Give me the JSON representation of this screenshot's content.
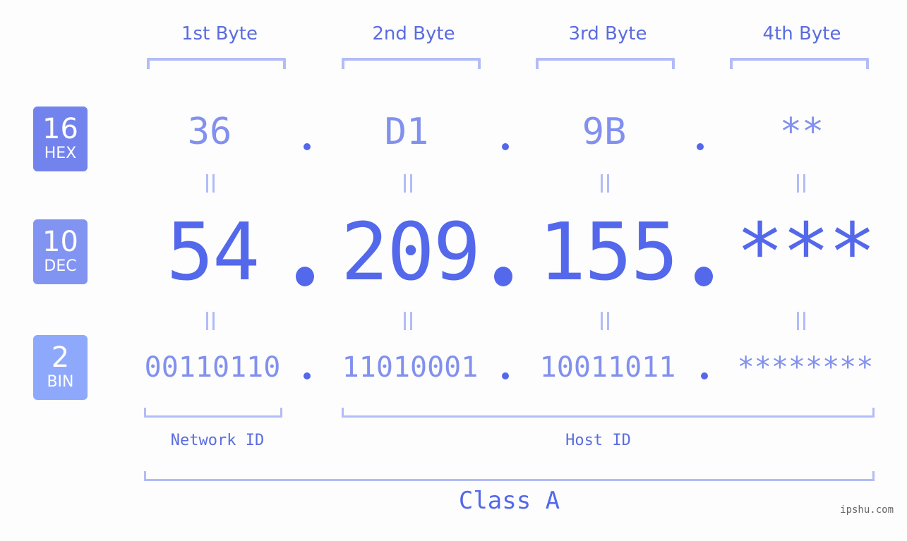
{
  "colors": {
    "hex_badge": "#7383ed",
    "dec_badge": "#8294f2",
    "bin_badge": "#8ea8fb",
    "accent": "#5468eb",
    "muted_value": "#8290ee",
    "bracket": "#b3bcf6"
  },
  "bytes": [
    {
      "label": "1st Byte",
      "hex": "36",
      "dec": "54",
      "bin": "00110110"
    },
    {
      "label": "2nd Byte",
      "hex": "D1",
      "dec": "209",
      "bin": "11010001"
    },
    {
      "label": "3rd Byte",
      "hex": "9B",
      "dec": "155",
      "bin": "10011011"
    },
    {
      "label": "4th Byte",
      "hex": "**",
      "dec": "***",
      "bin": "********"
    }
  ],
  "badges": {
    "hex": {
      "number": "16",
      "name": "HEX"
    },
    "dec": {
      "number": "10",
      "name": "DEC"
    },
    "bin": {
      "number": "2",
      "name": "BIN"
    }
  },
  "network_id_label": "Network ID",
  "host_id_label": "Host ID",
  "class_label": "Class A",
  "watermark": "ipshu.com"
}
